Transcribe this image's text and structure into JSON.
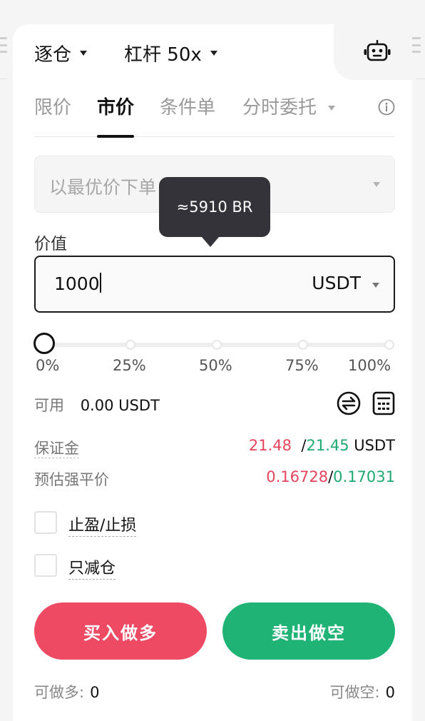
{
  "header": {
    "margin_mode": "逐仓",
    "leverage": "杠杆 50x"
  },
  "tabs": [
    {
      "label": "限价"
    },
    {
      "label": "市价"
    },
    {
      "label": "条件单"
    },
    {
      "label": "分时委托"
    }
  ],
  "price_select": {
    "placeholder": "以最优价下单"
  },
  "tooltip": {
    "text": "≈5910 BR"
  },
  "value": {
    "label": "价值",
    "amount": "1000",
    "unit": "USDT"
  },
  "slider": {
    "level": 0,
    "ticks": [
      "0%",
      "25%",
      "50%",
      "75%",
      "100%"
    ]
  },
  "available": {
    "label": "可用",
    "amount": "0.00 USDT"
  },
  "margin": {
    "label": "保证金",
    "buy": "21.48",
    "sell": "21.45",
    "unit": "USDT"
  },
  "liq_price": {
    "label": "预估强平价",
    "buy": "0.16728",
    "sell": "0.17031"
  },
  "checkboxes": {
    "tp_sl": "止盈/止损",
    "reduce_only": "只减仓"
  },
  "buttons": {
    "buy": "买入做多",
    "sell": "卖出做空"
  },
  "max": {
    "long_label": "可做多:",
    "long_value": "0",
    "short_label": "可做空:",
    "short_value": "0"
  },
  "colors": {
    "buy": "#ef4a63",
    "sell": "#1fb476",
    "buy_text": "#e5445d",
    "sell_text": "#1fa971"
  },
  "icons": [
    "robot-icon",
    "info-icon",
    "swap-icon",
    "calculator-icon",
    "caret-down-icon"
  ]
}
